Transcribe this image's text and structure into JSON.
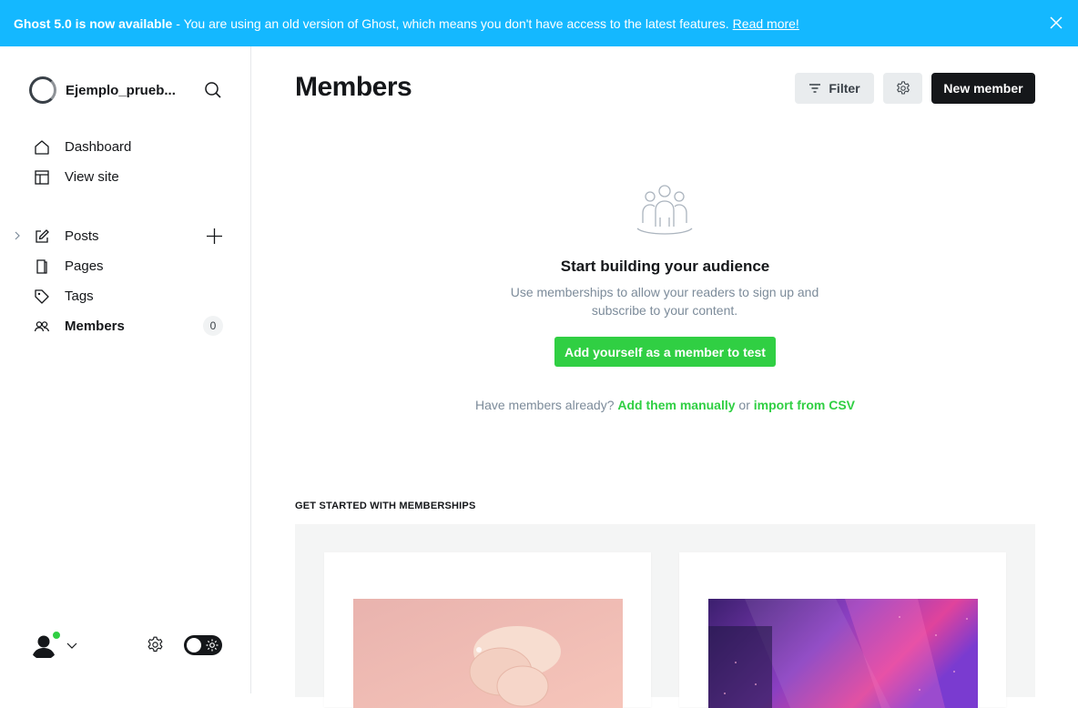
{
  "banner": {
    "bold_text": "Ghost 5.0 is now available",
    "text": "- You are using an old version of Ghost, which means you don't have access to the latest features.",
    "link_text": "Read more!"
  },
  "sidebar": {
    "site_name": "Ejemplo_prueb...",
    "items": [
      {
        "label": "Dashboard",
        "icon": "home-icon"
      },
      {
        "label": "View site",
        "icon": "layout-icon"
      },
      {
        "label": "Posts",
        "icon": "edit-icon"
      },
      {
        "label": "Pages",
        "icon": "page-icon"
      },
      {
        "label": "Tags",
        "icon": "tag-icon"
      },
      {
        "label": "Members",
        "icon": "members-icon",
        "badge": "0"
      }
    ]
  },
  "header": {
    "title": "Members",
    "filter_label": "Filter",
    "new_member_label": "New member"
  },
  "empty_state": {
    "title": "Start building your audience",
    "description": "Use memberships to allow your readers to sign up and subscribe to your content.",
    "add_self_label": "Add yourself as a member to test",
    "have_members_text": "Have members already?",
    "add_manually_label": "Add them manually",
    "or_text": "or",
    "import_csv_label": "import from CSV"
  },
  "get_started": {
    "heading": "GET STARTED WITH MEMBERSHIPS"
  },
  "colors": {
    "banner": "#14b8ff",
    "accent_green": "#30cf43",
    "dark": "#15171a"
  }
}
